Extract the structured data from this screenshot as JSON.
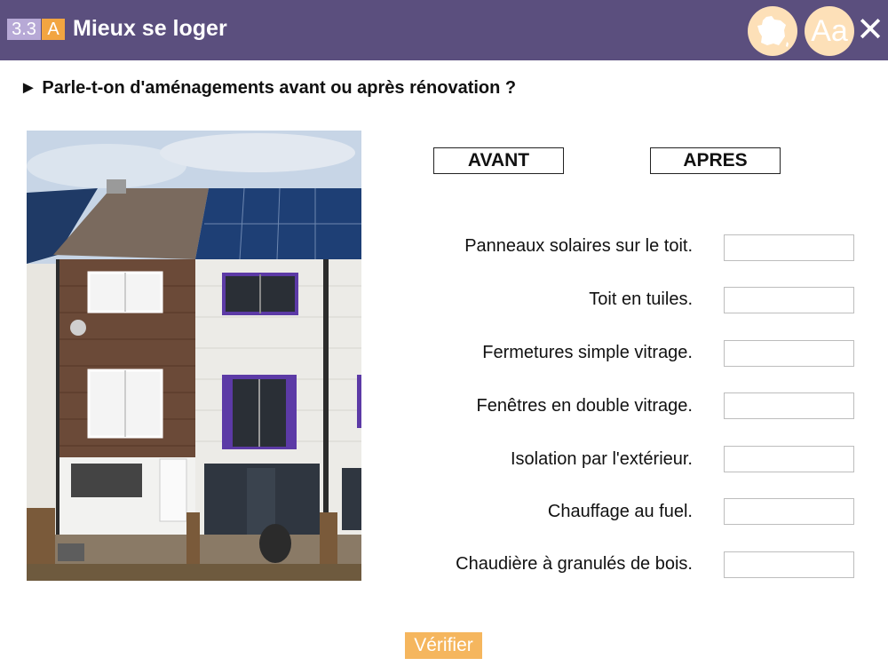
{
  "header": {
    "section_number": "3.3",
    "section_letter": "A",
    "title": "Mieux se loger",
    "font_button_label": "Aa",
    "close_label": "✕",
    "map_icon": "france-map-icon",
    "colors": {
      "bar": "#5b4f7e",
      "badge_number": "#b7a9d6",
      "badge_letter": "#f2a541",
      "circle": "#fde0b8"
    }
  },
  "question": "► Parle-t-on d'aménagements avant ou après rénovation ?",
  "columns": {
    "avant": "AVANT",
    "apres": "APRES"
  },
  "items": [
    {
      "label": "Panneaux solaires sur le toit.",
      "answer": ""
    },
    {
      "label": "Toit en tuiles.",
      "answer": ""
    },
    {
      "label": "Fermetures simple vitrage.",
      "answer": ""
    },
    {
      "label": "Fenêtres en double vitrage.",
      "answer": ""
    },
    {
      "label": "Isolation par l'extérieur.",
      "answer": ""
    },
    {
      "label": "Chauffage au fuel.",
      "answer": ""
    },
    {
      "label": "Chaudière à granulés de bois.",
      "answer": ""
    }
  ],
  "verify_label": "Vérifier"
}
